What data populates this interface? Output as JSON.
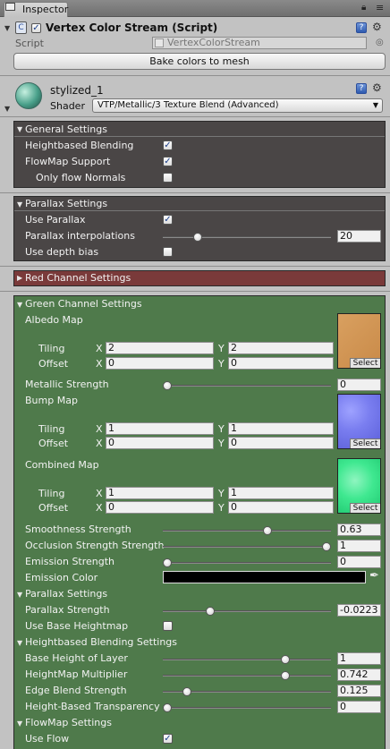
{
  "tab": {
    "title": "Inspector"
  },
  "component": {
    "title": "Vertex Color Stream (Script)",
    "enabled": true,
    "script_label": "Script",
    "script_value": "VertexColorStream",
    "bake_button": "Bake colors to mesh"
  },
  "material": {
    "name": "stylized_1",
    "shader_label": "Shader",
    "shader_value": "VTP/Metallic/3 Texture Blend (Advanced)"
  },
  "general": {
    "title": "General Settings",
    "heightbased": "Heightbased Blending",
    "flowmap": "FlowMap Support",
    "only_flow": "Only flow Normals"
  },
  "parallax": {
    "title": "Parallax Settings",
    "use": "Use Parallax",
    "interp": "Parallax interpolations",
    "interp_value": "20",
    "interp_fraction": 0.19,
    "depth_bias": "Use depth bias"
  },
  "red": {
    "title": "Red Channel Settings"
  },
  "green": {
    "title": "Green Channel Settings",
    "albedo": "Albedo Map",
    "metallic": "Metallic Strength",
    "metallic_value": "0",
    "metallic_fraction": 0.0,
    "bump": "Bump Map",
    "combined": "Combined Map",
    "tiling": "Tiling",
    "offset": "Offset",
    "x": "X",
    "y": "Y",
    "albedo_tiling": [
      "2",
      "2"
    ],
    "albedo_offset": [
      "0",
      "0"
    ],
    "bump_tiling": [
      "1",
      "1"
    ],
    "bump_offset": [
      "0",
      "0"
    ],
    "combined_tiling": [
      "1",
      "1"
    ],
    "combined_offset": [
      "0",
      "0"
    ],
    "select": "Select",
    "smoothness": "Smoothness Strength",
    "smoothness_value": "0.63",
    "smoothness_fraction": 0.63,
    "occlusion": "Occlusion Strength Strength",
    "occlusion_value": "1",
    "occlusion_fraction": 1.0,
    "emission": "Emission Strength",
    "emission_value": "0",
    "emission_fraction": 0.0,
    "emission_color": "Emission Color",
    "emission_color_hex": "#000000",
    "albedo_color": "#d9a060",
    "bump_color": "#7a7ef0",
    "combined_color": "#3fe890"
  },
  "green_parallax": {
    "title": "Parallax Settings",
    "strength": "Parallax Strength",
    "strength_value": "-0.0223",
    "strength_fraction": 0.27,
    "base_heightmap": "Use Base Heightmap"
  },
  "heightblend": {
    "title": "Heightbased Blending Settings",
    "base_height": "Base Height of Layer",
    "base_height_value": "1",
    "base_height_fraction": 0.74,
    "multiplier": "HeightMap Multiplier",
    "multiplier_value": "0.742",
    "multiplier_fraction": 0.742,
    "edge": "Edge Blend Strength",
    "edge_value": "0.125",
    "edge_fraction": 0.125,
    "transparency": "Height-Based Transparency",
    "transparency_value": "0",
    "transparency_fraction": 0.0
  },
  "flowmap": {
    "title": "FlowMap Settings",
    "use_flow": "Use Flow"
  },
  "colors": {
    "panel_dark": "#4a4646",
    "panel_red": "#7a3a3a",
    "panel_green": "#4f7a4b"
  }
}
